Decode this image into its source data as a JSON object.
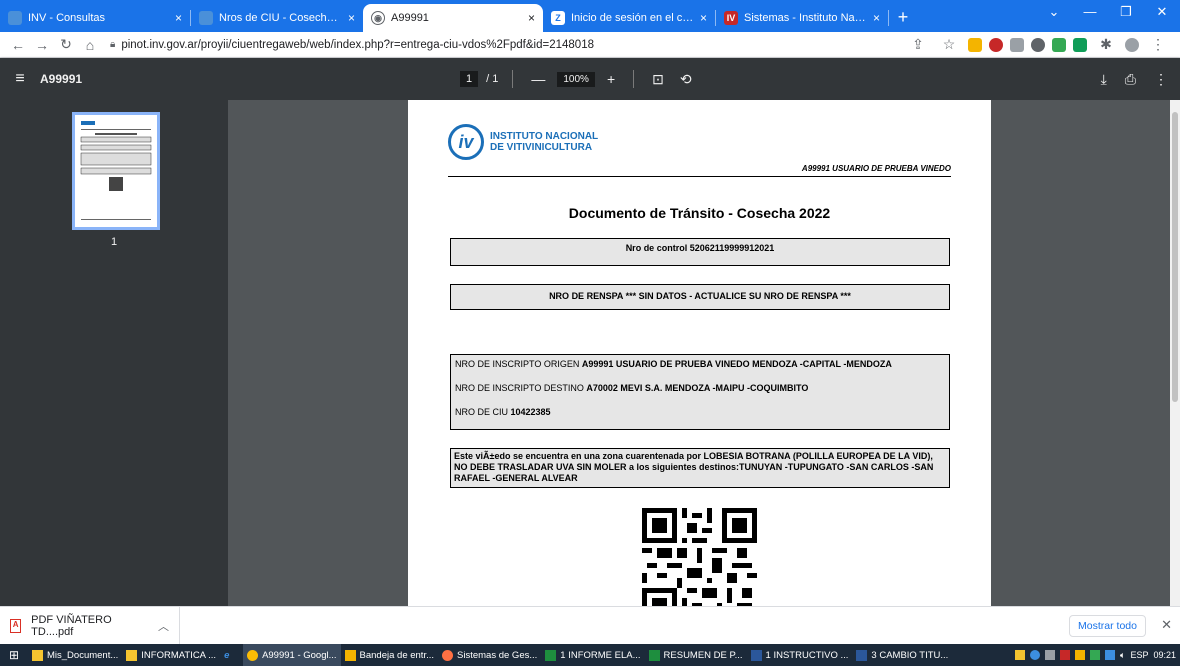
{
  "tabs": [
    {
      "title": "INV - Consultas",
      "close": "×"
    },
    {
      "title": "Nros de CIU - Cosecha Año 2022",
      "close": "×"
    },
    {
      "title": "A99991",
      "close": "×"
    },
    {
      "title": "Inicio de sesión en el cliente web",
      "close": "×"
    },
    {
      "title": "Sistemas - Instituto Nacional de",
      "close": "×"
    }
  ],
  "new_tab": "+",
  "window_controls": {
    "minimize": "—",
    "restore": "❐",
    "close": "✕",
    "more": "⌄"
  },
  "address": {
    "url": "pinot.inv.gov.ar/proyii/ciuentregaweb/web/index.php?r=entrega-ciu-vdos%2Fpdf&id=2148018"
  },
  "pdf_toolbar": {
    "title": "A99991",
    "page_current": "1",
    "page_total": "/ 1",
    "zoom": "100%",
    "minus": "—",
    "plus": "+"
  },
  "sidebar": {
    "thumb_page": "1"
  },
  "document": {
    "logo_line1": "INSTITUTO NACIONAL",
    "logo_line2": "DE VITIVINICULTURA",
    "user_line": "A99991 USUARIO DE PRUEBA VINEDO",
    "heading": "Documento de Tránsito - Cosecha 2022",
    "control": "Nro de control 52062119999912021",
    "renspa": "NRO DE RENSPA *** SIN DATOS - ACTUALICE SU NRO DE RENSPA ***",
    "origen_label": "NRO DE INSCRIPTO ORIGEN ",
    "origen_value": "A99991 USUARIO DE PRUEBA VINEDO MENDOZA -CAPITAL -MENDOZA",
    "destino_label": "NRO DE INSCRIPTO DESTINO ",
    "destino_value": "A70002 MEVI S.A. MENDOZA -MAIPU -COQUIMBITO",
    "ciu_label": "NRO DE CIU ",
    "ciu_value": "10422385",
    "warning": "Este viÃ±edo se encuentra en una zona cuarentenada por LOBESIA BOTRANA (POLILLA EUROPEA DE LA VID), NO DEBE TRASLADAR UVA SIN MOLER a los siguientes destinos:TUNUYAN -TUPUNGATO -SAN CARLOS -SAN RAFAEL -GENERAL ALVEAR"
  },
  "download": {
    "file": "PDF VIÑATERO TD....pdf",
    "show_all": "Mostrar todo",
    "close": "✕"
  },
  "taskbar": {
    "items": [
      "Mis_Document...",
      "INFORMATICA ...",
      "A99991 - Googl...",
      "Bandeja de entr...",
      "Sistemas de Ges...",
      "1 INFORME ELA...",
      "RESUMEN DE P...",
      "1 INSTRUCTIVO ...",
      "3 CAMBIO TITU..."
    ],
    "lang": "ESP",
    "time": "09:21"
  }
}
